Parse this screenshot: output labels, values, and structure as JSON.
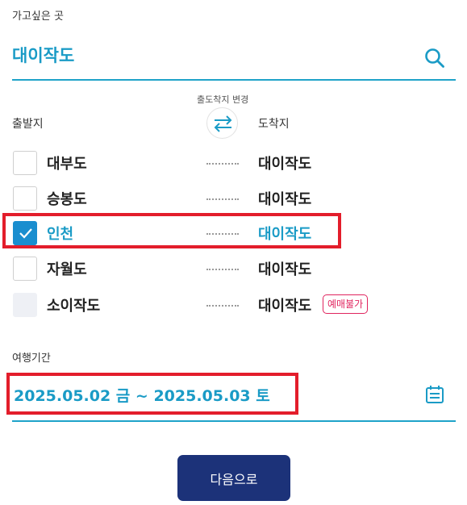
{
  "destination": {
    "label": "가고싶은 곳",
    "value": "대이작도"
  },
  "routes": {
    "swap_label": "출도착지 변경",
    "departure_title": "출발지",
    "arrival_title": "도착지",
    "items": [
      {
        "departure": "대부도",
        "arrival": "대이작도",
        "checked": false,
        "disabled": false
      },
      {
        "departure": "승봉도",
        "arrival": "대이작도",
        "checked": false,
        "disabled": false
      },
      {
        "departure": "인천",
        "arrival": "대이작도",
        "checked": true,
        "disabled": false
      },
      {
        "departure": "자월도",
        "arrival": "대이작도",
        "checked": false,
        "disabled": false
      },
      {
        "departure": "소이작도",
        "arrival": "대이작도",
        "checked": false,
        "disabled": true,
        "badge": "예매불가"
      }
    ]
  },
  "period": {
    "label": "여행기간",
    "value": "2025.05.02 금 ~ 2025.05.03 토"
  },
  "next_button": "다음으로",
  "colors": {
    "accent": "#1a9bc6",
    "primary_button": "#1c3279",
    "highlight": "#e31d2b",
    "badge": "#e0245e"
  }
}
